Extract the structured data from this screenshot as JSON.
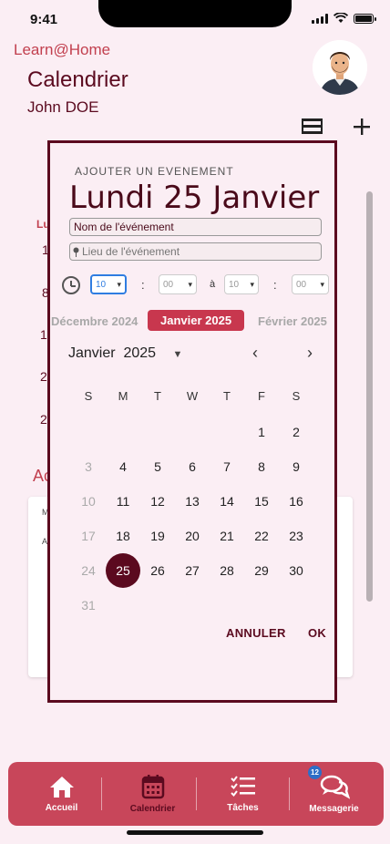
{
  "status_bar": {
    "time": "9:41"
  },
  "header": {
    "brand": "Learn@Home",
    "page_title": "Calendrier",
    "user_name": "John DOE"
  },
  "background": {
    "weekday_fragment": "Lu",
    "row_numbers": [
      "1",
      "8",
      "1",
      "2",
      "2"
    ],
    "section_fragment": "Ac",
    "card_fragments": [
      "M",
      "A"
    ]
  },
  "modal": {
    "label": "AJOUTER UN EVENEMENT",
    "date_title": "Lundi 25 Janvier",
    "event_name_placeholder": "Nom de l'événement",
    "event_location_placeholder": "Lieu de l'événement",
    "time": {
      "start_hour": "10",
      "start_minute": "00",
      "separator": ":",
      "between": "à",
      "end_hour": "10",
      "end_minute": "00"
    },
    "month_tabs": {
      "previous": "Décembre 2024",
      "current": "Janvier 2025",
      "next": "Février 2025"
    },
    "calendar": {
      "month": "Janvier",
      "year": "2025",
      "weekdays": [
        "S",
        "M",
        "T",
        "W",
        "T",
        "F",
        "S"
      ],
      "weeks": [
        [
          "",
          "",
          "",
          "",
          "",
          "1",
          "2"
        ],
        [
          "3",
          "4",
          "5",
          "6",
          "7",
          "8",
          "9"
        ],
        [
          "10",
          "11",
          "12",
          "13",
          "14",
          "15",
          "16"
        ],
        [
          "17",
          "18",
          "19",
          "20",
          "21",
          "22",
          "23"
        ],
        [
          "24",
          "25",
          "26",
          "27",
          "28",
          "29",
          "30"
        ],
        [
          "31",
          "",
          "",
          "",
          "",
          "",
          ""
        ]
      ],
      "selected_day": "25",
      "muted_days": [
        "3",
        "10",
        "17",
        "24",
        "31"
      ]
    },
    "actions": {
      "cancel": "ANNULER",
      "ok": "OK"
    }
  },
  "bottom_nav": {
    "items": [
      {
        "label": "Accueil",
        "icon": "home-icon"
      },
      {
        "label": "Calendrier",
        "icon": "calendar-icon"
      },
      {
        "label": "Tâches",
        "icon": "tasks-icon"
      },
      {
        "label": "Messagerie",
        "icon": "messages-icon",
        "badge": "12"
      }
    ],
    "active": "Calendrier"
  },
  "colors": {
    "primary": "#5b0a1f",
    "accent": "#c8465a",
    "background": "#fbeef4",
    "badge": "#2e6ec7"
  }
}
